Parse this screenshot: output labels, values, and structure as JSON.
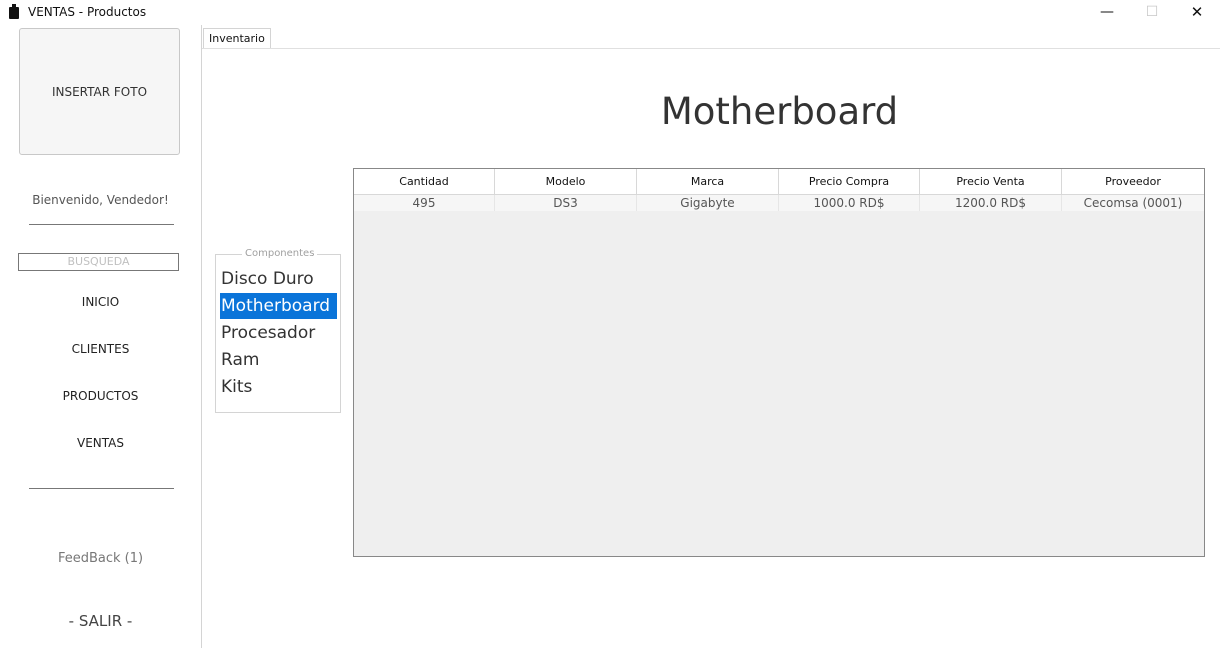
{
  "window": {
    "title": "VENTAS - Productos",
    "minimize_glyph": "—",
    "maximize_glyph": "☐",
    "close_glyph": "✕"
  },
  "sidebar": {
    "photo_label": "INSERTAR FOTO",
    "welcome": "Bienvenido, Vendedor!",
    "search_placeholder": "BUSQUEDA",
    "nav": [
      "INICIO",
      "CLIENTES",
      "PRODUCTOS",
      "VENTAS"
    ],
    "feedback": "FeedBack (1)",
    "exit": "- SALIR -"
  },
  "tabs": [
    "Inventario"
  ],
  "main": {
    "heading": "Motherboard",
    "components_legend": "Componentes",
    "components": [
      "Disco Duro",
      "Motherboard",
      "Procesador",
      "Ram",
      "Kits"
    ],
    "selected_component": "Motherboard",
    "selected_color": "#0a74d9"
  },
  "table": {
    "columns": [
      "Cantidad",
      "Modelo",
      "Marca",
      "Precio Compra",
      "Precio Venta",
      "Proveedor"
    ],
    "rows": [
      [
        "495",
        "DS3",
        "Gigabyte",
        "1000.0 RD$",
        "1200.0 RD$",
        "Cecomsa (0001)"
      ]
    ]
  }
}
